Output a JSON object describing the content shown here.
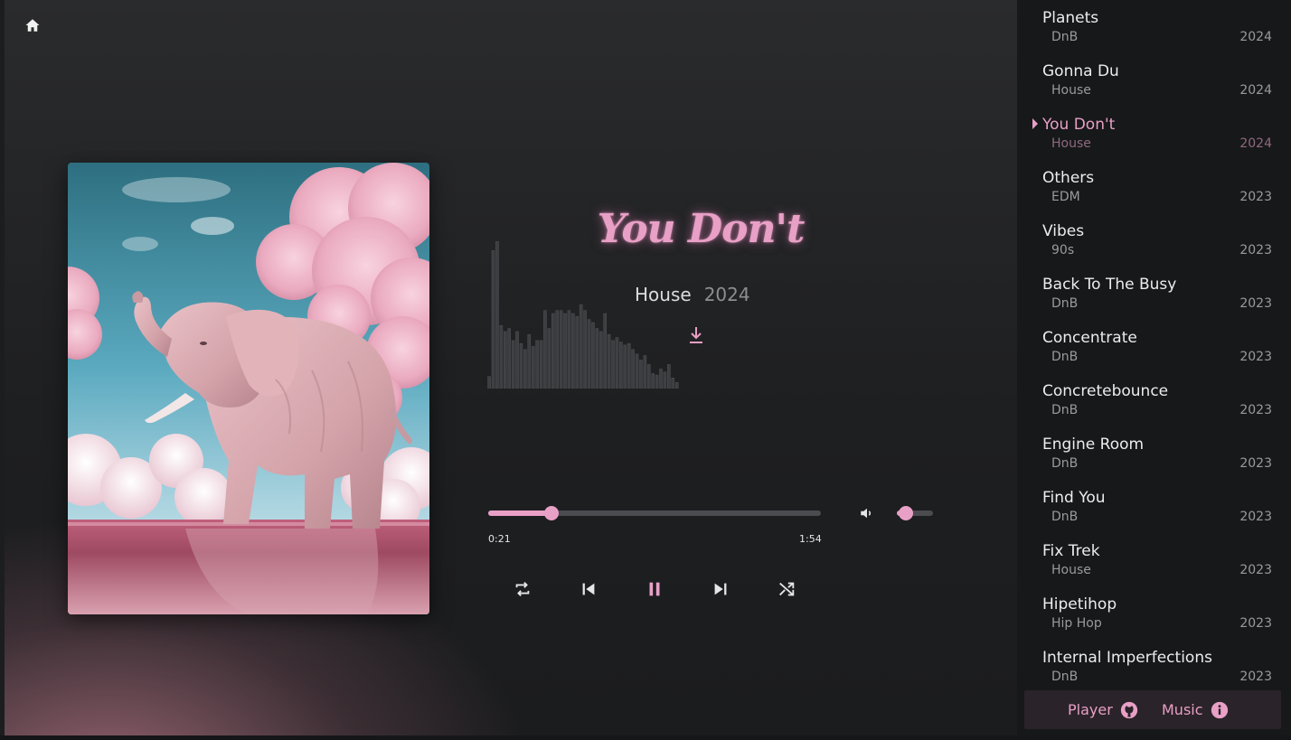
{
  "player": {
    "title": "You Don't",
    "genre": "House",
    "year": "2024",
    "progress_fraction": 0.19,
    "volume_fraction": 0.25,
    "time_current": "0:21",
    "time_total": "1:54",
    "waveform_levels": [
      0.08,
      0.92,
      0.98,
      0.42,
      0.38,
      0.4,
      0.32,
      0.38,
      0.3,
      0.26,
      0.36,
      0.28,
      0.32,
      0.32,
      0.52,
      0.4,
      0.5,
      0.52,
      0.52,
      0.5,
      0.52,
      0.5,
      0.48,
      0.56,
      0.52,
      0.46,
      0.44,
      0.4,
      0.38,
      0.5,
      0.36,
      0.32,
      0.34,
      0.31,
      0.29,
      0.3,
      0.26,
      0.23,
      0.19,
      0.22,
      0.16,
      0.1,
      0.09,
      0.13,
      0.11,
      0.16,
      0.07,
      0.04
    ]
  },
  "icons": {
    "home": "home-icon",
    "download": "download-icon",
    "volume": "volume-icon",
    "repeat": "repeat-icon",
    "previous": "skip-previous-icon",
    "pause": "pause-icon",
    "next": "skip-next-icon",
    "shuffle": "shuffle-icon",
    "github": "github-icon",
    "info": "info-icon"
  },
  "colors": {
    "accent": "#e8a0c6",
    "sidebar_bg": "#17181a",
    "footer_bg": "#2a2329"
  },
  "playlist": [
    {
      "title": "Planets",
      "genre": "DnB",
      "year": "2024"
    },
    {
      "title": "Gonna Du",
      "genre": "House",
      "year": "2024"
    },
    {
      "title": "You Don't",
      "genre": "House",
      "year": "2024",
      "active": true
    },
    {
      "title": "Others",
      "genre": "EDM",
      "year": "2023"
    },
    {
      "title": "Vibes",
      "genre": "90s",
      "year": "2023"
    },
    {
      "title": "Back To The Busy",
      "genre": "DnB",
      "year": "2023"
    },
    {
      "title": "Concentrate",
      "genre": "DnB",
      "year": "2023"
    },
    {
      "title": "Concretebounce",
      "genre": "DnB",
      "year": "2023"
    },
    {
      "title": "Engine Room",
      "genre": "DnB",
      "year": "2023"
    },
    {
      "title": "Find You",
      "genre": "DnB",
      "year": "2023"
    },
    {
      "title": "Fix Trek",
      "genre": "House",
      "year": "2023"
    },
    {
      "title": "Hipetihop",
      "genre": "Hip Hop",
      "year": "2023"
    },
    {
      "title": "Internal Imperfections",
      "genre": "DnB",
      "year": "2023"
    }
  ],
  "footer": {
    "player_label": "Player",
    "music_label": "Music"
  }
}
